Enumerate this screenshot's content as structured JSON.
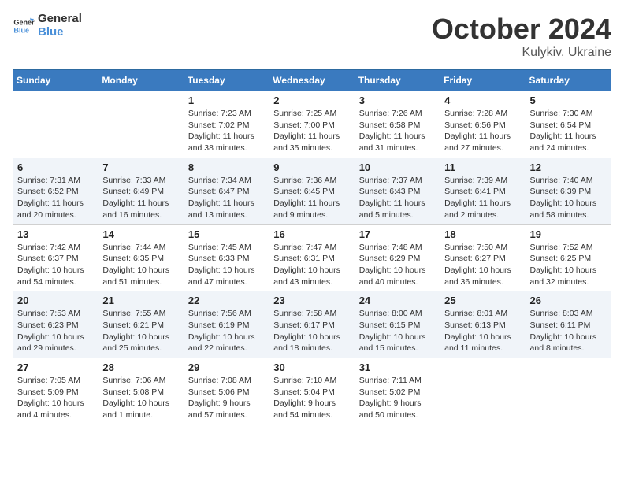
{
  "header": {
    "logo_general": "General",
    "logo_blue": "Blue",
    "month_title": "October 2024",
    "location": "Kulykiv, Ukraine"
  },
  "days_of_week": [
    "Sunday",
    "Monday",
    "Tuesday",
    "Wednesday",
    "Thursday",
    "Friday",
    "Saturday"
  ],
  "weeks": [
    [
      {
        "day": "",
        "info": ""
      },
      {
        "day": "",
        "info": ""
      },
      {
        "day": "1",
        "info": "Sunrise: 7:23 AM\nSunset: 7:02 PM\nDaylight: 11 hours and 38 minutes."
      },
      {
        "day": "2",
        "info": "Sunrise: 7:25 AM\nSunset: 7:00 PM\nDaylight: 11 hours and 35 minutes."
      },
      {
        "day": "3",
        "info": "Sunrise: 7:26 AM\nSunset: 6:58 PM\nDaylight: 11 hours and 31 minutes."
      },
      {
        "day": "4",
        "info": "Sunrise: 7:28 AM\nSunset: 6:56 PM\nDaylight: 11 hours and 27 minutes."
      },
      {
        "day": "5",
        "info": "Sunrise: 7:30 AM\nSunset: 6:54 PM\nDaylight: 11 hours and 24 minutes."
      }
    ],
    [
      {
        "day": "6",
        "info": "Sunrise: 7:31 AM\nSunset: 6:52 PM\nDaylight: 11 hours and 20 minutes."
      },
      {
        "day": "7",
        "info": "Sunrise: 7:33 AM\nSunset: 6:49 PM\nDaylight: 11 hours and 16 minutes."
      },
      {
        "day": "8",
        "info": "Sunrise: 7:34 AM\nSunset: 6:47 PM\nDaylight: 11 hours and 13 minutes."
      },
      {
        "day": "9",
        "info": "Sunrise: 7:36 AM\nSunset: 6:45 PM\nDaylight: 11 hours and 9 minutes."
      },
      {
        "day": "10",
        "info": "Sunrise: 7:37 AM\nSunset: 6:43 PM\nDaylight: 11 hours and 5 minutes."
      },
      {
        "day": "11",
        "info": "Sunrise: 7:39 AM\nSunset: 6:41 PM\nDaylight: 11 hours and 2 minutes."
      },
      {
        "day": "12",
        "info": "Sunrise: 7:40 AM\nSunset: 6:39 PM\nDaylight: 10 hours and 58 minutes."
      }
    ],
    [
      {
        "day": "13",
        "info": "Sunrise: 7:42 AM\nSunset: 6:37 PM\nDaylight: 10 hours and 54 minutes."
      },
      {
        "day": "14",
        "info": "Sunrise: 7:44 AM\nSunset: 6:35 PM\nDaylight: 10 hours and 51 minutes."
      },
      {
        "day": "15",
        "info": "Sunrise: 7:45 AM\nSunset: 6:33 PM\nDaylight: 10 hours and 47 minutes."
      },
      {
        "day": "16",
        "info": "Sunrise: 7:47 AM\nSunset: 6:31 PM\nDaylight: 10 hours and 43 minutes."
      },
      {
        "day": "17",
        "info": "Sunrise: 7:48 AM\nSunset: 6:29 PM\nDaylight: 10 hours and 40 minutes."
      },
      {
        "day": "18",
        "info": "Sunrise: 7:50 AM\nSunset: 6:27 PM\nDaylight: 10 hours and 36 minutes."
      },
      {
        "day": "19",
        "info": "Sunrise: 7:52 AM\nSunset: 6:25 PM\nDaylight: 10 hours and 32 minutes."
      }
    ],
    [
      {
        "day": "20",
        "info": "Sunrise: 7:53 AM\nSunset: 6:23 PM\nDaylight: 10 hours and 29 minutes."
      },
      {
        "day": "21",
        "info": "Sunrise: 7:55 AM\nSunset: 6:21 PM\nDaylight: 10 hours and 25 minutes."
      },
      {
        "day": "22",
        "info": "Sunrise: 7:56 AM\nSunset: 6:19 PM\nDaylight: 10 hours and 22 minutes."
      },
      {
        "day": "23",
        "info": "Sunrise: 7:58 AM\nSunset: 6:17 PM\nDaylight: 10 hours and 18 minutes."
      },
      {
        "day": "24",
        "info": "Sunrise: 8:00 AM\nSunset: 6:15 PM\nDaylight: 10 hours and 15 minutes."
      },
      {
        "day": "25",
        "info": "Sunrise: 8:01 AM\nSunset: 6:13 PM\nDaylight: 10 hours and 11 minutes."
      },
      {
        "day": "26",
        "info": "Sunrise: 8:03 AM\nSunset: 6:11 PM\nDaylight: 10 hours and 8 minutes."
      }
    ],
    [
      {
        "day": "27",
        "info": "Sunrise: 7:05 AM\nSunset: 5:09 PM\nDaylight: 10 hours and 4 minutes."
      },
      {
        "day": "28",
        "info": "Sunrise: 7:06 AM\nSunset: 5:08 PM\nDaylight: 10 hours and 1 minute."
      },
      {
        "day": "29",
        "info": "Sunrise: 7:08 AM\nSunset: 5:06 PM\nDaylight: 9 hours and 57 minutes."
      },
      {
        "day": "30",
        "info": "Sunrise: 7:10 AM\nSunset: 5:04 PM\nDaylight: 9 hours and 54 minutes."
      },
      {
        "day": "31",
        "info": "Sunrise: 7:11 AM\nSunset: 5:02 PM\nDaylight: 9 hours and 50 minutes."
      },
      {
        "day": "",
        "info": ""
      },
      {
        "day": "",
        "info": ""
      }
    ]
  ]
}
